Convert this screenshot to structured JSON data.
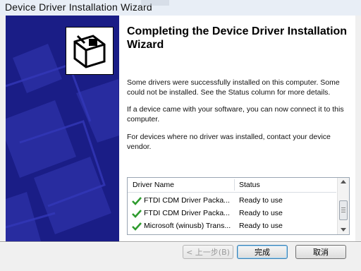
{
  "window": {
    "title": "Device Driver Installation Wizard"
  },
  "heading": "Completing the Device Driver Installation Wizard",
  "paragraphs": [
    "Some drivers were successfully installed on this computer. Some could not be installed. See the Status column for more details.",
    "If a device came with your software, you can now connect it to this computer.",
    "For devices where no driver was installed, contact your device vendor."
  ],
  "table": {
    "columns": [
      "Driver Name",
      "Status"
    ],
    "rows": [
      {
        "name": "FTDI CDM Driver Packa...",
        "status": "Ready to use",
        "icon": "green-check-icon"
      },
      {
        "name": "FTDI CDM Driver Packa...",
        "status": "Ready to use",
        "icon": "green-check-icon"
      },
      {
        "name": "Microsoft (winusb) Trans...",
        "status": "Ready to use",
        "icon": "green-check-icon"
      }
    ]
  },
  "buttons": {
    "back": "< 上一步(B)",
    "finish": "完成",
    "cancel": "取消"
  },
  "colors": {
    "sidebar": "#1a1d86",
    "check": "#2e9b2e",
    "accent": "#3c7fb1"
  }
}
